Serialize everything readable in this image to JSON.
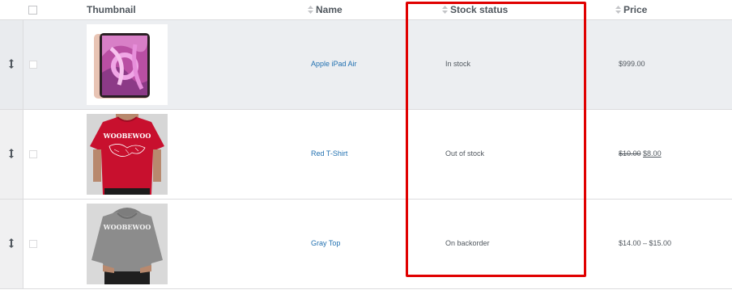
{
  "header": {
    "thumbnail": "Thumbnail",
    "name": "Name",
    "stock_status": "Stock status",
    "price": "Price"
  },
  "rows": [
    {
      "name": "Apple iPad Air",
      "stock": "In stock",
      "price": "$999.00",
      "image": "ipad-air-thumbnail"
    },
    {
      "name": "Red T-Shirt",
      "stock": "Out of stock",
      "price_regular": "$10.00",
      "price_sale": "$8.00",
      "image": "red-tshirt-thumbnail",
      "shirt_text": "WOOBEWOO"
    },
    {
      "name": "Gray Top",
      "stock": "On backorder",
      "price": "$14.00 – $15.00",
      "image": "gray-hoodie-thumbnail",
      "shirt_text": "WOOBEWOO"
    }
  ],
  "colors": {
    "link": "#2271b1",
    "text": "#50575e",
    "highlight": "#e00000",
    "row_alt": "#eceef1"
  }
}
